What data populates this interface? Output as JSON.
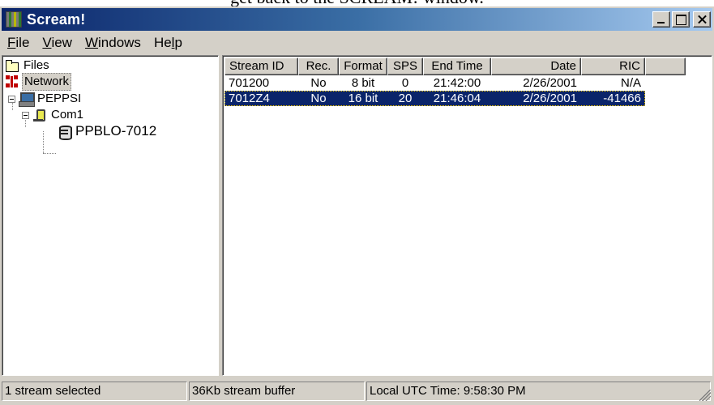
{
  "caption": "get back to the SCREAM! window.",
  "window": {
    "title": "Scream!"
  },
  "menu": {
    "file": {
      "accel": "F",
      "rest": "ile"
    },
    "view": {
      "accel": "V",
      "rest": "iew"
    },
    "windows": {
      "accel": "W",
      "rest": "indows"
    },
    "help": {
      "pre": "He",
      "accel": "l",
      "rest": "p"
    }
  },
  "tree": {
    "files": "Files",
    "network": "Network",
    "host": "PEPPSI",
    "port": "Com1",
    "device": "PPBLO-7012"
  },
  "columns": {
    "stream_id": "Stream ID",
    "rec": "Rec.",
    "format": "Format",
    "sps": "SPS",
    "end_time": "End Time",
    "date": "Date",
    "ric": "RIC"
  },
  "rows": [
    {
      "stream_id": "701200",
      "rec": "No",
      "format": "8 bit",
      "sps": "0",
      "end_time": "21:42:00",
      "date": "2/26/2001",
      "ric": "N/A"
    },
    {
      "stream_id": "7012Z4",
      "rec": "No",
      "format": "16 bit",
      "sps": "20",
      "end_time": "21:46:04",
      "date": "2/26/2001",
      "ric": "-41466"
    }
  ],
  "status": {
    "selection": "1 stream selected",
    "buffer": "36Kb stream buffer",
    "time": "Local UTC Time:  9:58:30 PM"
  },
  "colors": {
    "titlebar": "#0a246a",
    "selection": "#0a246a",
    "face": "#d4d0c8"
  }
}
